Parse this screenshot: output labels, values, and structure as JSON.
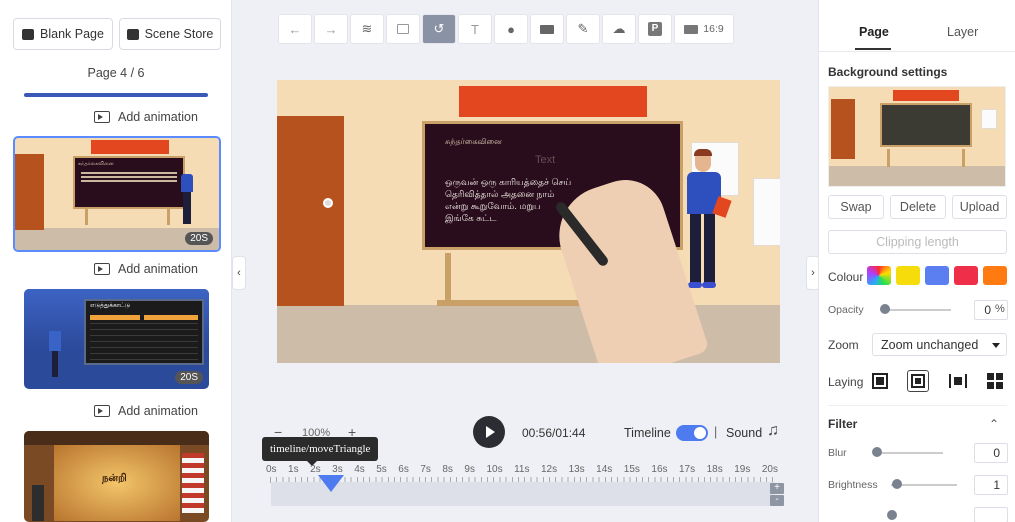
{
  "left_panel": {
    "blank_page_label": "Blank Page",
    "scene_store_label": "Scene Store",
    "page_counter": "Page 4 / 6",
    "add_animation_label": "Add animation",
    "thumbnails": [
      {
        "duration": "20S",
        "board_title": "சுந்தர்கைவினை"
      },
      {
        "duration": "20S",
        "board_title": "எடுத்துக்காட்டு"
      },
      {
        "board_title": "நன்றி"
      }
    ]
  },
  "toolbar": {
    "aspect_ratio": "16:9",
    "icons": [
      "undo-icon",
      "redo-icon",
      "layers-icon",
      "frame-icon",
      "hand-draw-icon",
      "text-icon",
      "microphone-icon",
      "camera-icon",
      "pen-icon",
      "cloud-icon",
      "p-icon",
      "aspect-ratio-icon"
    ]
  },
  "canvas": {
    "board_title": "சுந்தர்கைவினை",
    "placeholder_text": "Text",
    "board_lines": [
      "ஒருவன் ஒரு காரியத்தைச் செய்",
      "தெரிவித்தால் அதனை நாம்",
      "என்று கூறுவோம். மறுப",
      "இங்கே சுட்ட"
    ],
    "colors": {
      "wall": "#f6dcb4",
      "floor": "#cdbca8",
      "board": "#2a0d1c",
      "banner": "#e2471f",
      "door": "#b5521e"
    }
  },
  "timeline": {
    "zoom_minus": "−",
    "zoom_plus": "+",
    "zoom_level": "100%",
    "time": "00:56/01:44",
    "timeline_label": "Timeline",
    "separator": "|",
    "sound_label": "Sound",
    "tooltip": "timeline/moveTriangle",
    "ticks": [
      "0s",
      "1s",
      "2s",
      "3s",
      "4s",
      "5s",
      "6s",
      "7s",
      "8s",
      "9s",
      "10s",
      "11s",
      "12s",
      "13s",
      "14s",
      "15s",
      "16s",
      "17s",
      "18s",
      "19s",
      "20s"
    ],
    "add_track": "+",
    "remove_track": "-",
    "timeline_enabled": true
  },
  "right_panel": {
    "tabs": [
      "Page",
      "Layer"
    ],
    "background_settings": "Background settings",
    "swap_label": "Swap",
    "delete_label": "Delete",
    "upload_label": "Upload",
    "clipping_length": "Clipping length",
    "colour_label": "Colour",
    "swatches": [
      "#f5dc0a",
      "#5b7ff0",
      "#ef2f4a",
      "#ff7a10"
    ],
    "opacity_label": "Opacity",
    "opacity_value": "0",
    "opacity_unit": "%",
    "zoom_label": "Zoom",
    "zoom_value": "Zoom unchanged",
    "laying_label": "Laying",
    "filter_label": "Filter",
    "blur_label": "Blur",
    "blur_value": "0",
    "brightness_label": "Brightness",
    "brightness_value": "1",
    "accent": "#4e7bef"
  }
}
